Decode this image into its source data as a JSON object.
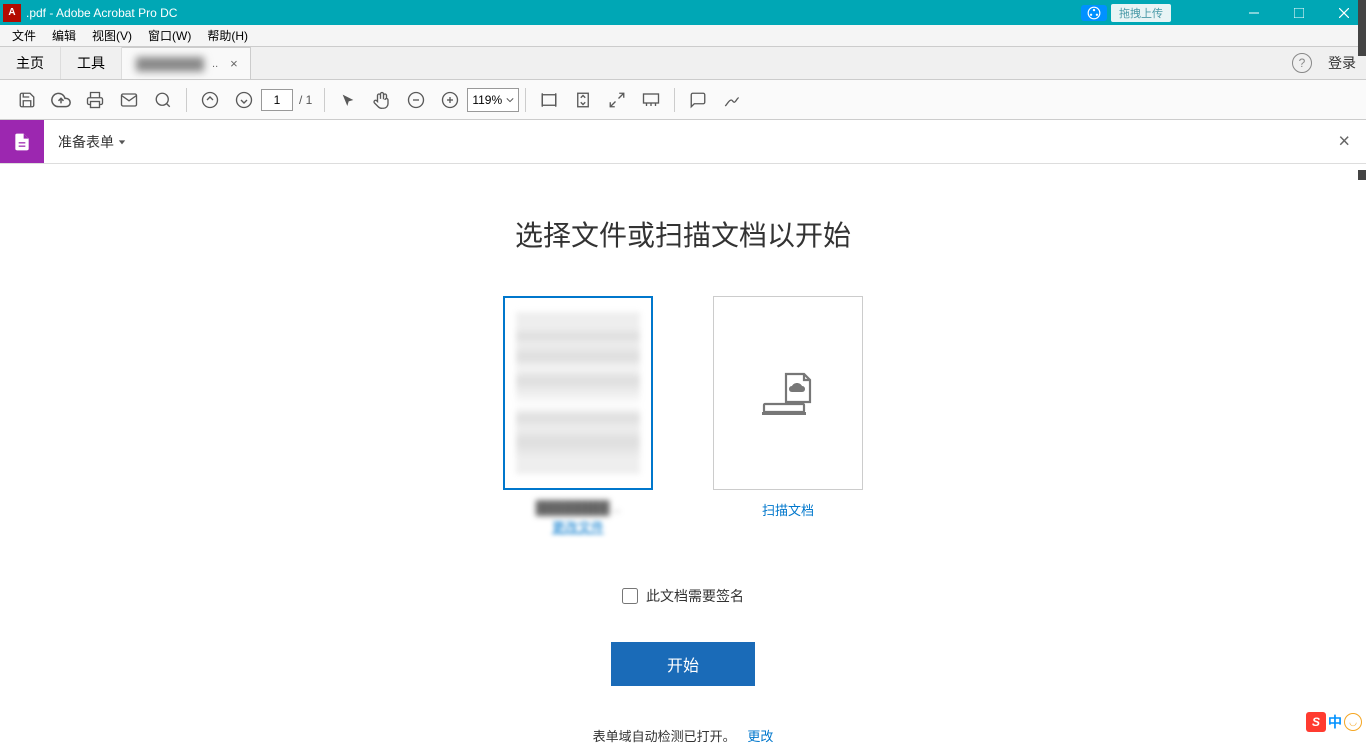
{
  "titlebar": {
    "title_suffix": ".pdf - Adobe Acrobat Pro DC",
    "upload_label": "拖拽上传"
  },
  "menubar": {
    "file": "文件",
    "edit": "编辑",
    "view": "视图(V)",
    "window": "窗口(W)",
    "help": "帮助(H)"
  },
  "tabs": {
    "home": "主页",
    "tools": "工具",
    "login": "登录"
  },
  "toolbar": {
    "page_current": "1",
    "page_total": "/ 1",
    "zoom": "119%"
  },
  "formbar": {
    "label": "准备表单"
  },
  "main": {
    "heading": "选择文件或扫描文档以开始",
    "change_file": "更改文件",
    "scan_label": "扫描文档",
    "checkbox_label": "此文档需要签名",
    "start_button": "开始",
    "footer_text": "表单域自动检测已打开。",
    "footer_link": "更改"
  },
  "tray": {
    "s": "S",
    "cn": "中"
  }
}
